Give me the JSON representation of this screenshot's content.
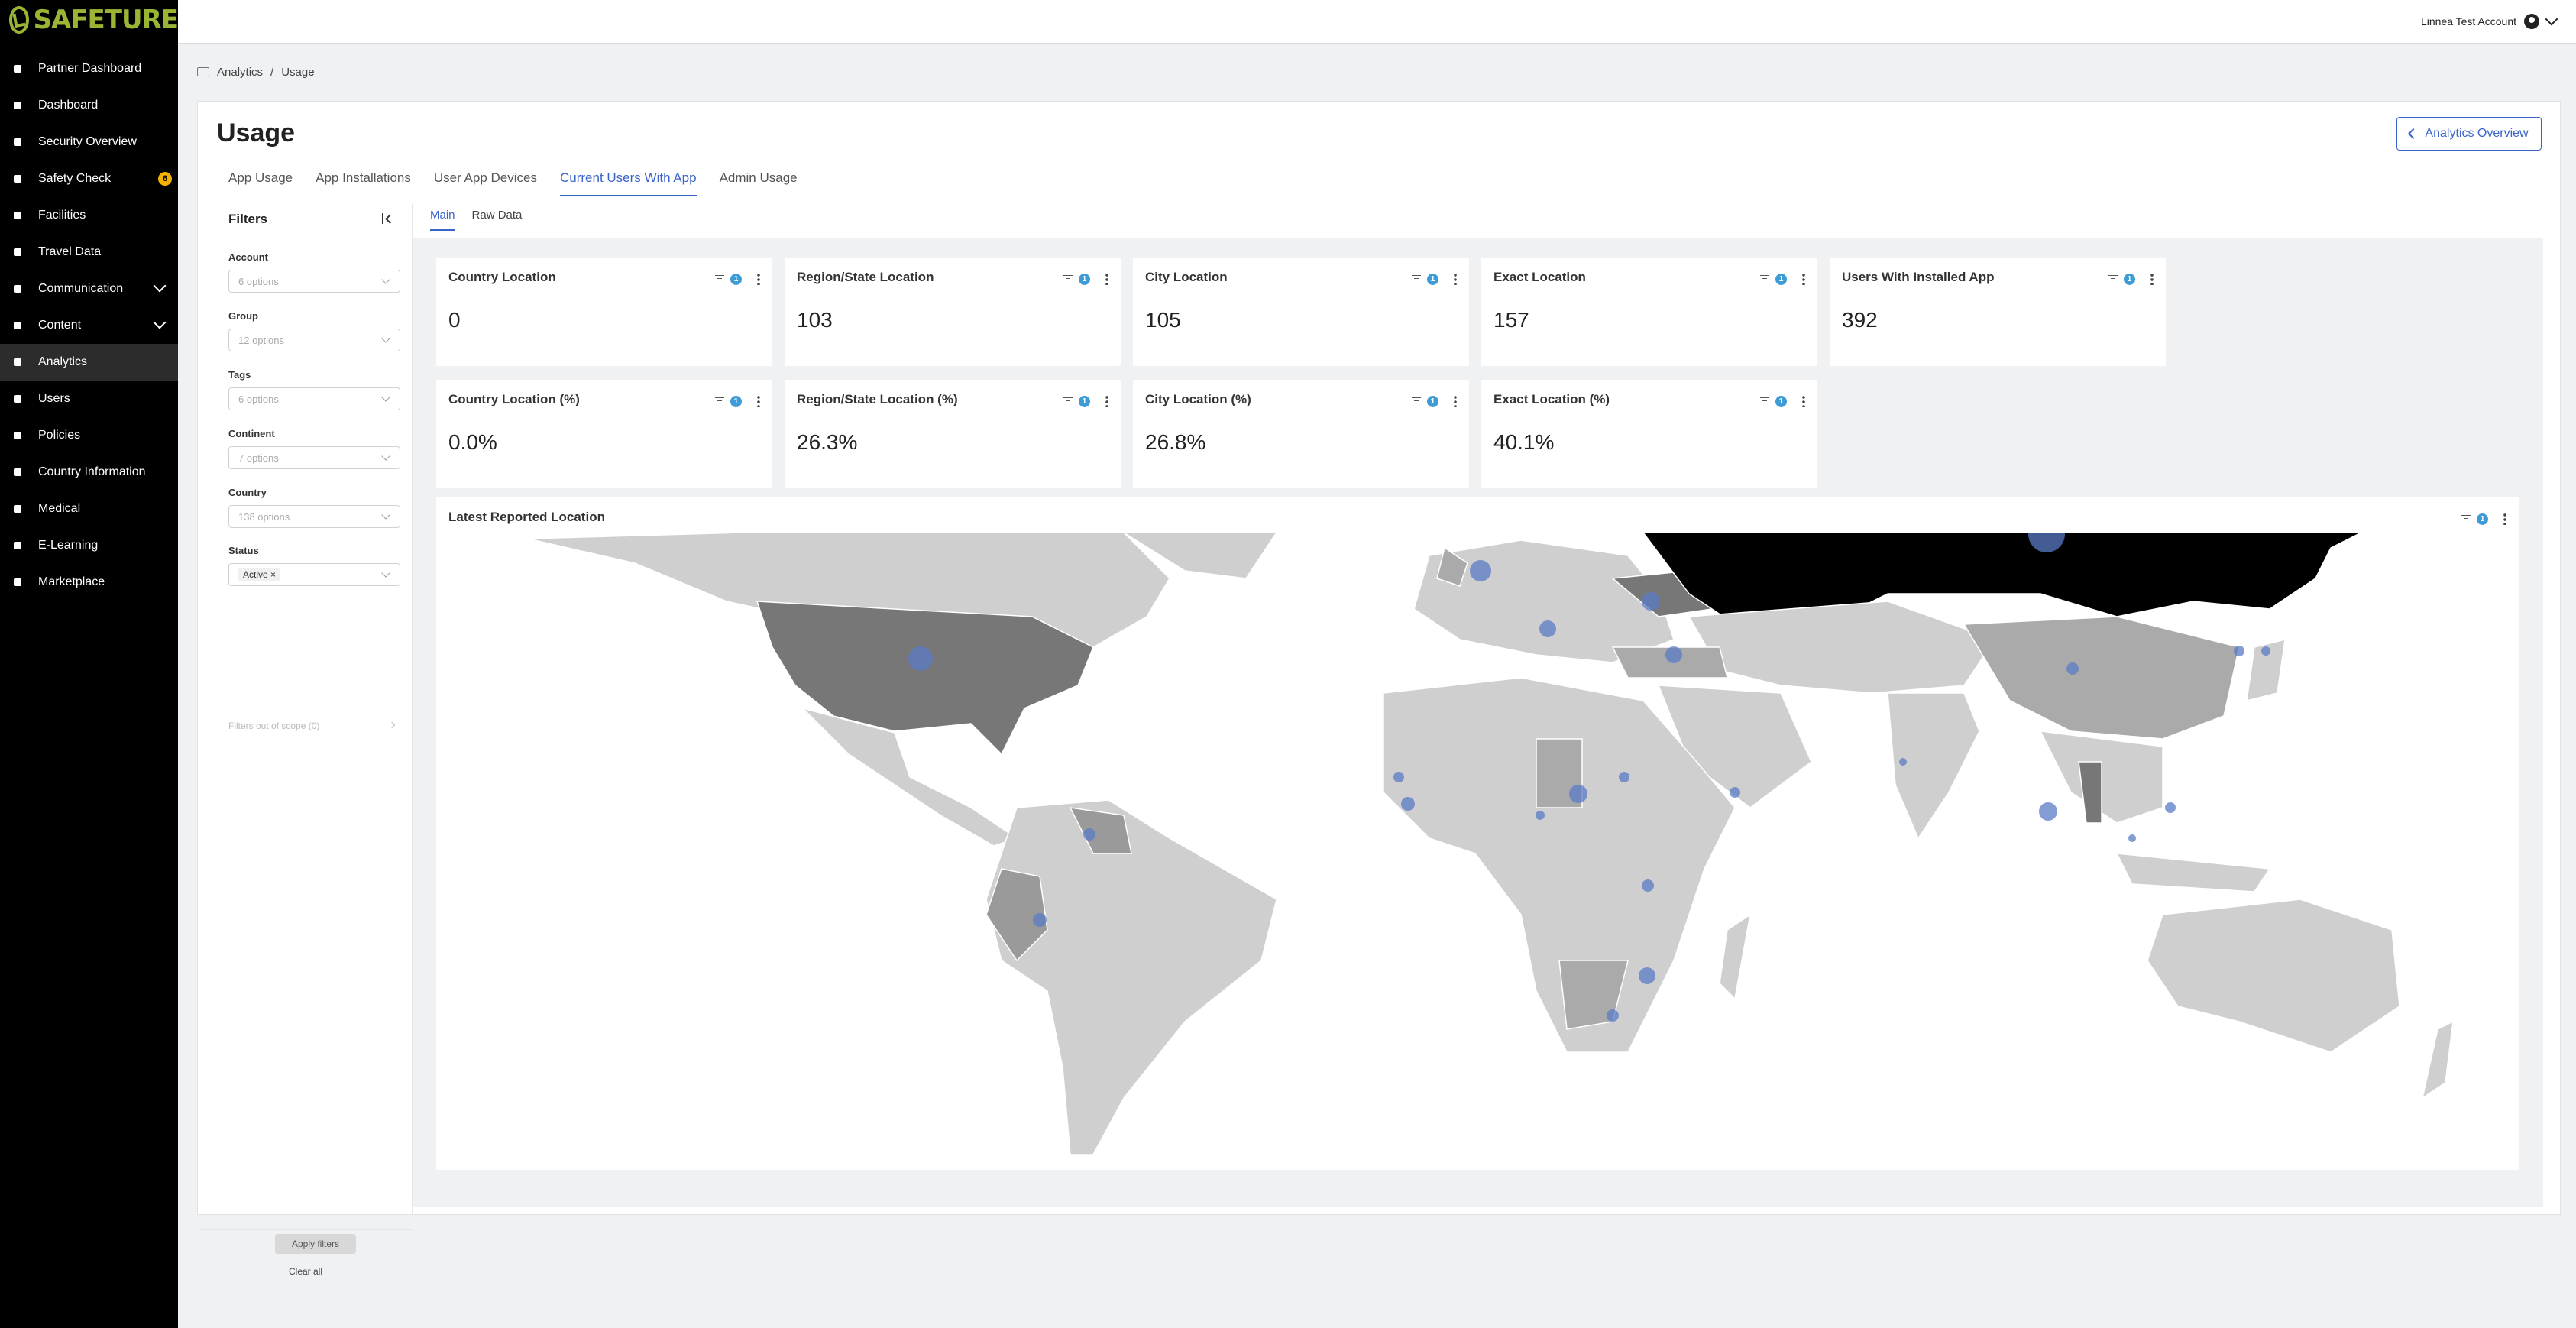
{
  "brand": {
    "name": "SAFETURE",
    "accent": "#9ab533"
  },
  "sidebar": {
    "items": [
      {
        "label": "Partner Dashboard",
        "icon": "handshake-icon"
      },
      {
        "label": "Dashboard",
        "icon": "gauge-icon"
      },
      {
        "label": "Security Overview",
        "icon": "globe-icon"
      },
      {
        "label": "Safety Check",
        "icon": "check-square-icon",
        "badge": "6"
      },
      {
        "label": "Facilities",
        "icon": "building-icon"
      },
      {
        "label": "Travel Data",
        "icon": "plane-icon"
      },
      {
        "label": "Communication",
        "icon": "megaphone-icon",
        "expandable": true
      },
      {
        "label": "Content",
        "icon": "pencil-icon",
        "expandable": true
      },
      {
        "label": "Analytics",
        "icon": "chart-icon",
        "active": true
      },
      {
        "label": "Users",
        "icon": "user-icon"
      },
      {
        "label": "Policies",
        "icon": "document-icon"
      },
      {
        "label": "Country Information",
        "icon": "flag-icon"
      },
      {
        "label": "Medical",
        "icon": "medkit-icon"
      },
      {
        "label": "E-Learning",
        "icon": "graduation-cap-icon"
      },
      {
        "label": "Marketplace",
        "icon": "puzzle-icon"
      }
    ]
  },
  "topbar": {
    "account_name": "Linnea Test Account"
  },
  "breadcrumb": {
    "root": "Analytics",
    "separator": "/",
    "current": "Usage"
  },
  "page": {
    "title": "Usage",
    "overview_button": "Analytics Overview"
  },
  "tabs": [
    "App Usage",
    "App Installations",
    "User App Devices",
    "Current Users With App",
    "Admin Usage"
  ],
  "active_tab": "Current Users With App",
  "filters": {
    "title": "Filters",
    "fields": [
      {
        "label": "Account",
        "value": "6 options"
      },
      {
        "label": "Group",
        "value": "12 options"
      },
      {
        "label": "Tags",
        "value": "6 options"
      },
      {
        "label": "Continent",
        "value": "7 options"
      },
      {
        "label": "Country",
        "value": "138 options"
      },
      {
        "label": "Status",
        "value": "Active"
      }
    ],
    "out_of_scope": "Filters out of scope (0)",
    "apply": "Apply filters",
    "clear": "Clear all"
  },
  "subtabs": [
    "Main",
    "Raw Data"
  ],
  "cards_row1": [
    {
      "title": "Country Location",
      "value": "0",
      "badge": "1"
    },
    {
      "title": "Region/State Location",
      "value": "103",
      "badge": "1"
    },
    {
      "title": "City Location",
      "value": "105",
      "badge": "1"
    },
    {
      "title": "Exact Location",
      "value": "157",
      "badge": "1"
    },
    {
      "title": "Users With Installed App",
      "value": "392",
      "badge": "1"
    }
  ],
  "cards_row2": [
    {
      "title": "Country Location (%)",
      "value": "0.0%",
      "badge": "1"
    },
    {
      "title": "Region/State Location (%)",
      "value": "26.3%",
      "badge": "1"
    },
    {
      "title": "City Location (%)",
      "value": "26.8%",
      "badge": "1"
    },
    {
      "title": "Exact Location (%)",
      "value": "40.1%",
      "badge": "1"
    }
  ],
  "map": {
    "title": "Latest Reported Location",
    "badge": "1",
    "bubble_color": "#5b7bc6"
  }
}
